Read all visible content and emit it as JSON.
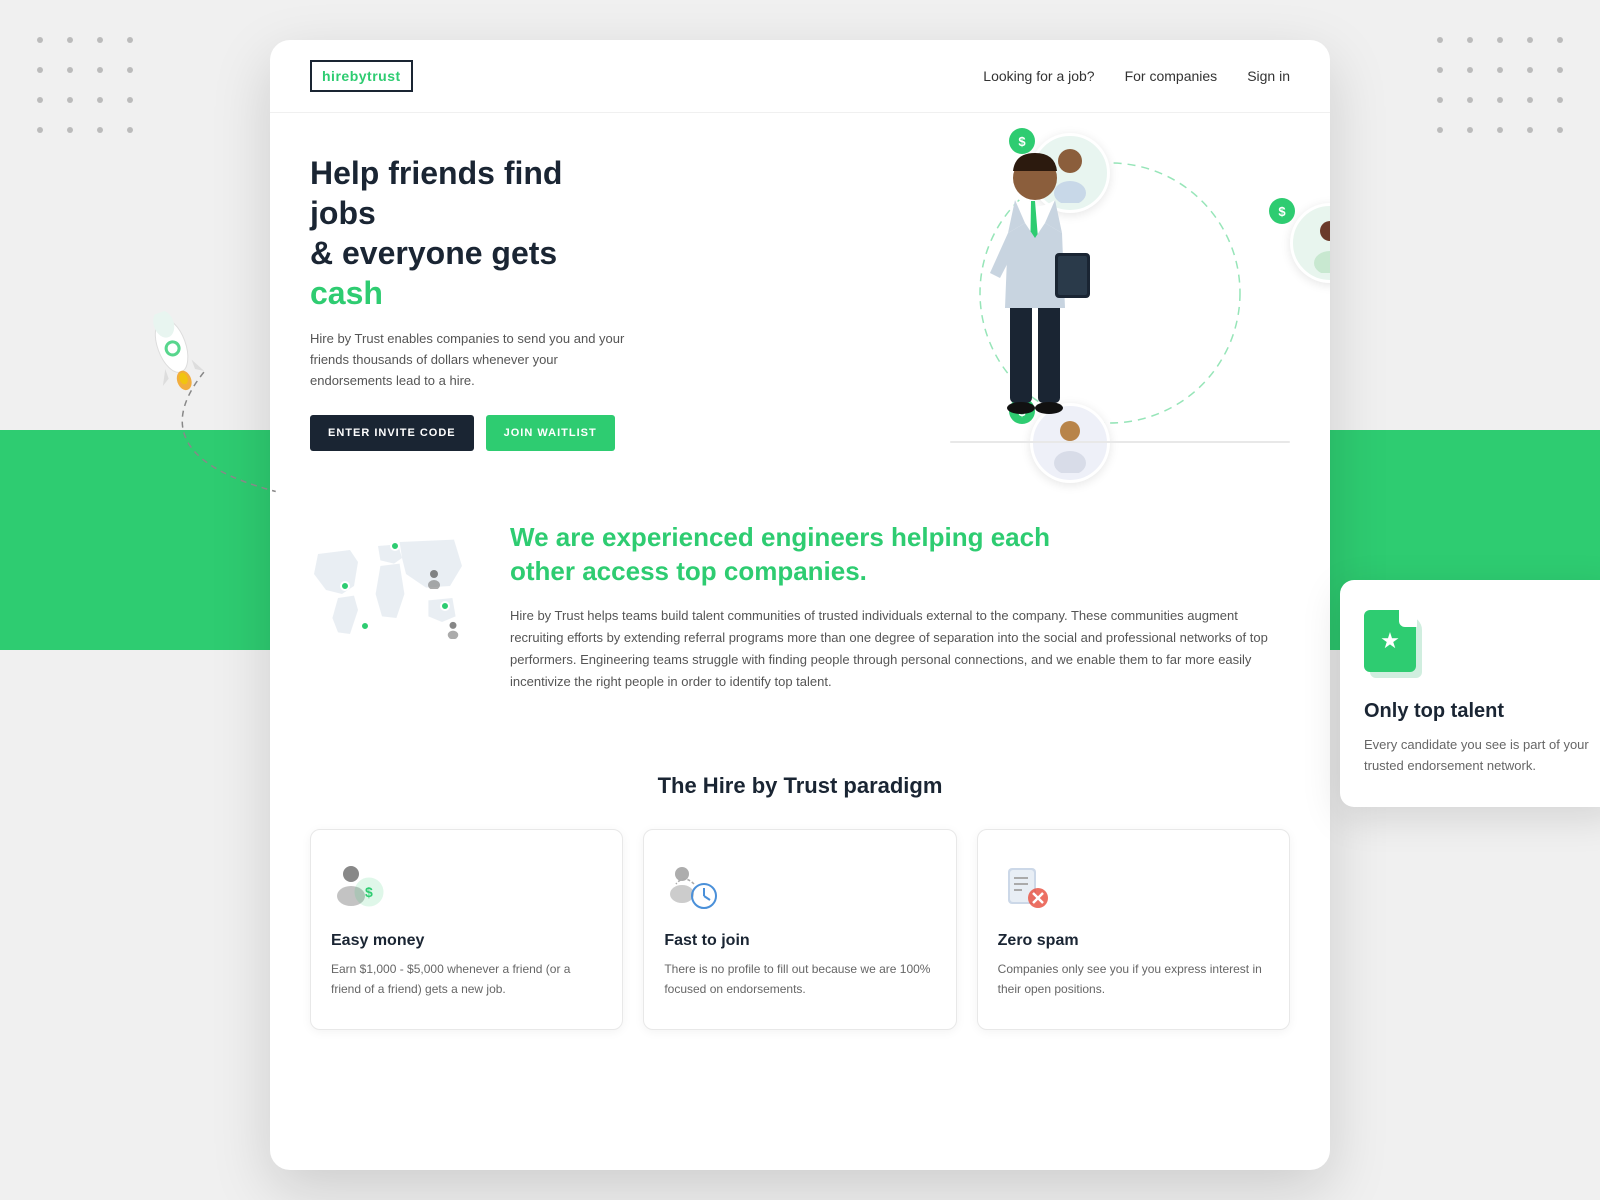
{
  "page": {
    "bg_color": "#f2f2f2"
  },
  "navbar": {
    "logo": {
      "hire": "hire",
      "by": "by",
      "trust": "trust"
    },
    "links": [
      {
        "label": "Looking for a job?",
        "key": "job"
      },
      {
        "label": "For companies",
        "key": "companies"
      },
      {
        "label": "Sign in",
        "key": "signin"
      }
    ]
  },
  "hero": {
    "title_line1": "Help friends find jobs",
    "title_line2": "& everyone gets ",
    "title_green": "cash",
    "subtitle": "Hire by Trust enables companies to send you and your friends thousands of dollars whenever your endorsements lead to a hire.",
    "btn_invite": "ENTER INVITE CODE",
    "btn_waitlist": "JOIN WAITLIST"
  },
  "about": {
    "title_line1": "We are experienced engineers helping each",
    "title_line2": "other access top companies.",
    "desc": "Hire by Trust helps teams build talent communities of trusted individuals external to the company. These communities augment recruiting efforts by extending referral programs more than one degree of separation into the social and professional networks of top performers. Engineering teams struggle with finding people through personal connections, and we enable them to far more easily incentivize the right people in order to identify top talent."
  },
  "paradigm": {
    "title": "The Hire by Trust paradigm",
    "cards": [
      {
        "key": "easy-money",
        "title": "Easy money",
        "desc": "Earn $1,000 - $5,000 whenever a friend (or a friend of a friend) gets a new job."
      },
      {
        "key": "fast-to-join",
        "title": "Fast to join",
        "desc": "There is no profile to fill out because we are 100% focused on endorsements."
      },
      {
        "key": "zero-spam",
        "title": "Zero spam",
        "desc": "Companies only see you if you express interest in their open positions."
      }
    ]
  },
  "talent_card": {
    "title": "Only top talent",
    "desc": "Every candidate you see is part of your trusted endorsement network."
  }
}
